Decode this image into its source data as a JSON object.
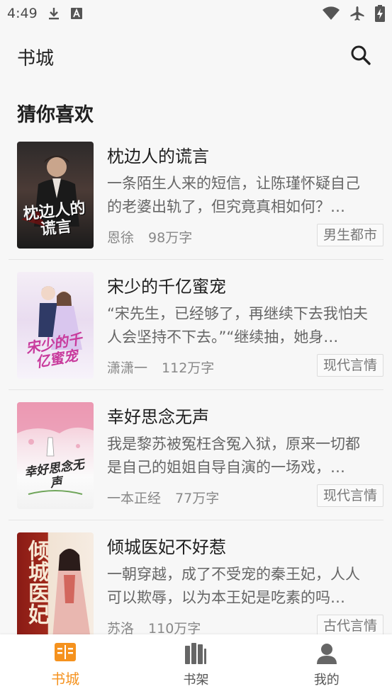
{
  "status_bar": {
    "time": "4:49"
  },
  "header": {
    "title": "书城"
  },
  "section": {
    "title": "猜你喜欢"
  },
  "books": [
    {
      "title": "枕边人的谎言",
      "description": "一条陌生人来的短信，让陈瑾怀疑自己的老婆出轨了，但究竟真相如何？…",
      "author": "恩徐",
      "word_count": "98万字",
      "tag": "男生都市",
      "cover_text": "枕边人的谎言"
    },
    {
      "title": "宋少的千亿蜜宠",
      "description": "“宋先生，已经够了，再继续下去我怕夫人会坚持不下去。”“继续抽，她身…",
      "author": "潇潇一",
      "word_count": "112万字",
      "tag": "现代言情",
      "cover_text": "宋少的千亿蜜宠"
    },
    {
      "title": "幸好思念无声",
      "description": "我是黎苏被冤枉含冤入狱，原来一切都是自己的姐姐自导自演的一场戏，…",
      "author": "一本正经",
      "word_count": "77万字",
      "tag": "现代言情",
      "cover_text": "幸好思念无声"
    },
    {
      "title": "倾城医妃不好惹",
      "description": "一朝穿越，成了不受宠的秦王妃，人人可以欺辱，以为本王妃是吃素的吗…",
      "author": "苏洛",
      "word_count": "110万字",
      "tag": "古代言情",
      "cover_text": "倾城医妃"
    }
  ],
  "nav": [
    {
      "label": "书城",
      "icon": "bookstore-icon",
      "active": true
    },
    {
      "label": "书架",
      "icon": "bookshelf-icon",
      "active": false
    },
    {
      "label": "我的",
      "icon": "profile-icon",
      "active": false
    }
  ],
  "colors": {
    "accent": "#f5921e",
    "background": "#f7f7f7"
  }
}
